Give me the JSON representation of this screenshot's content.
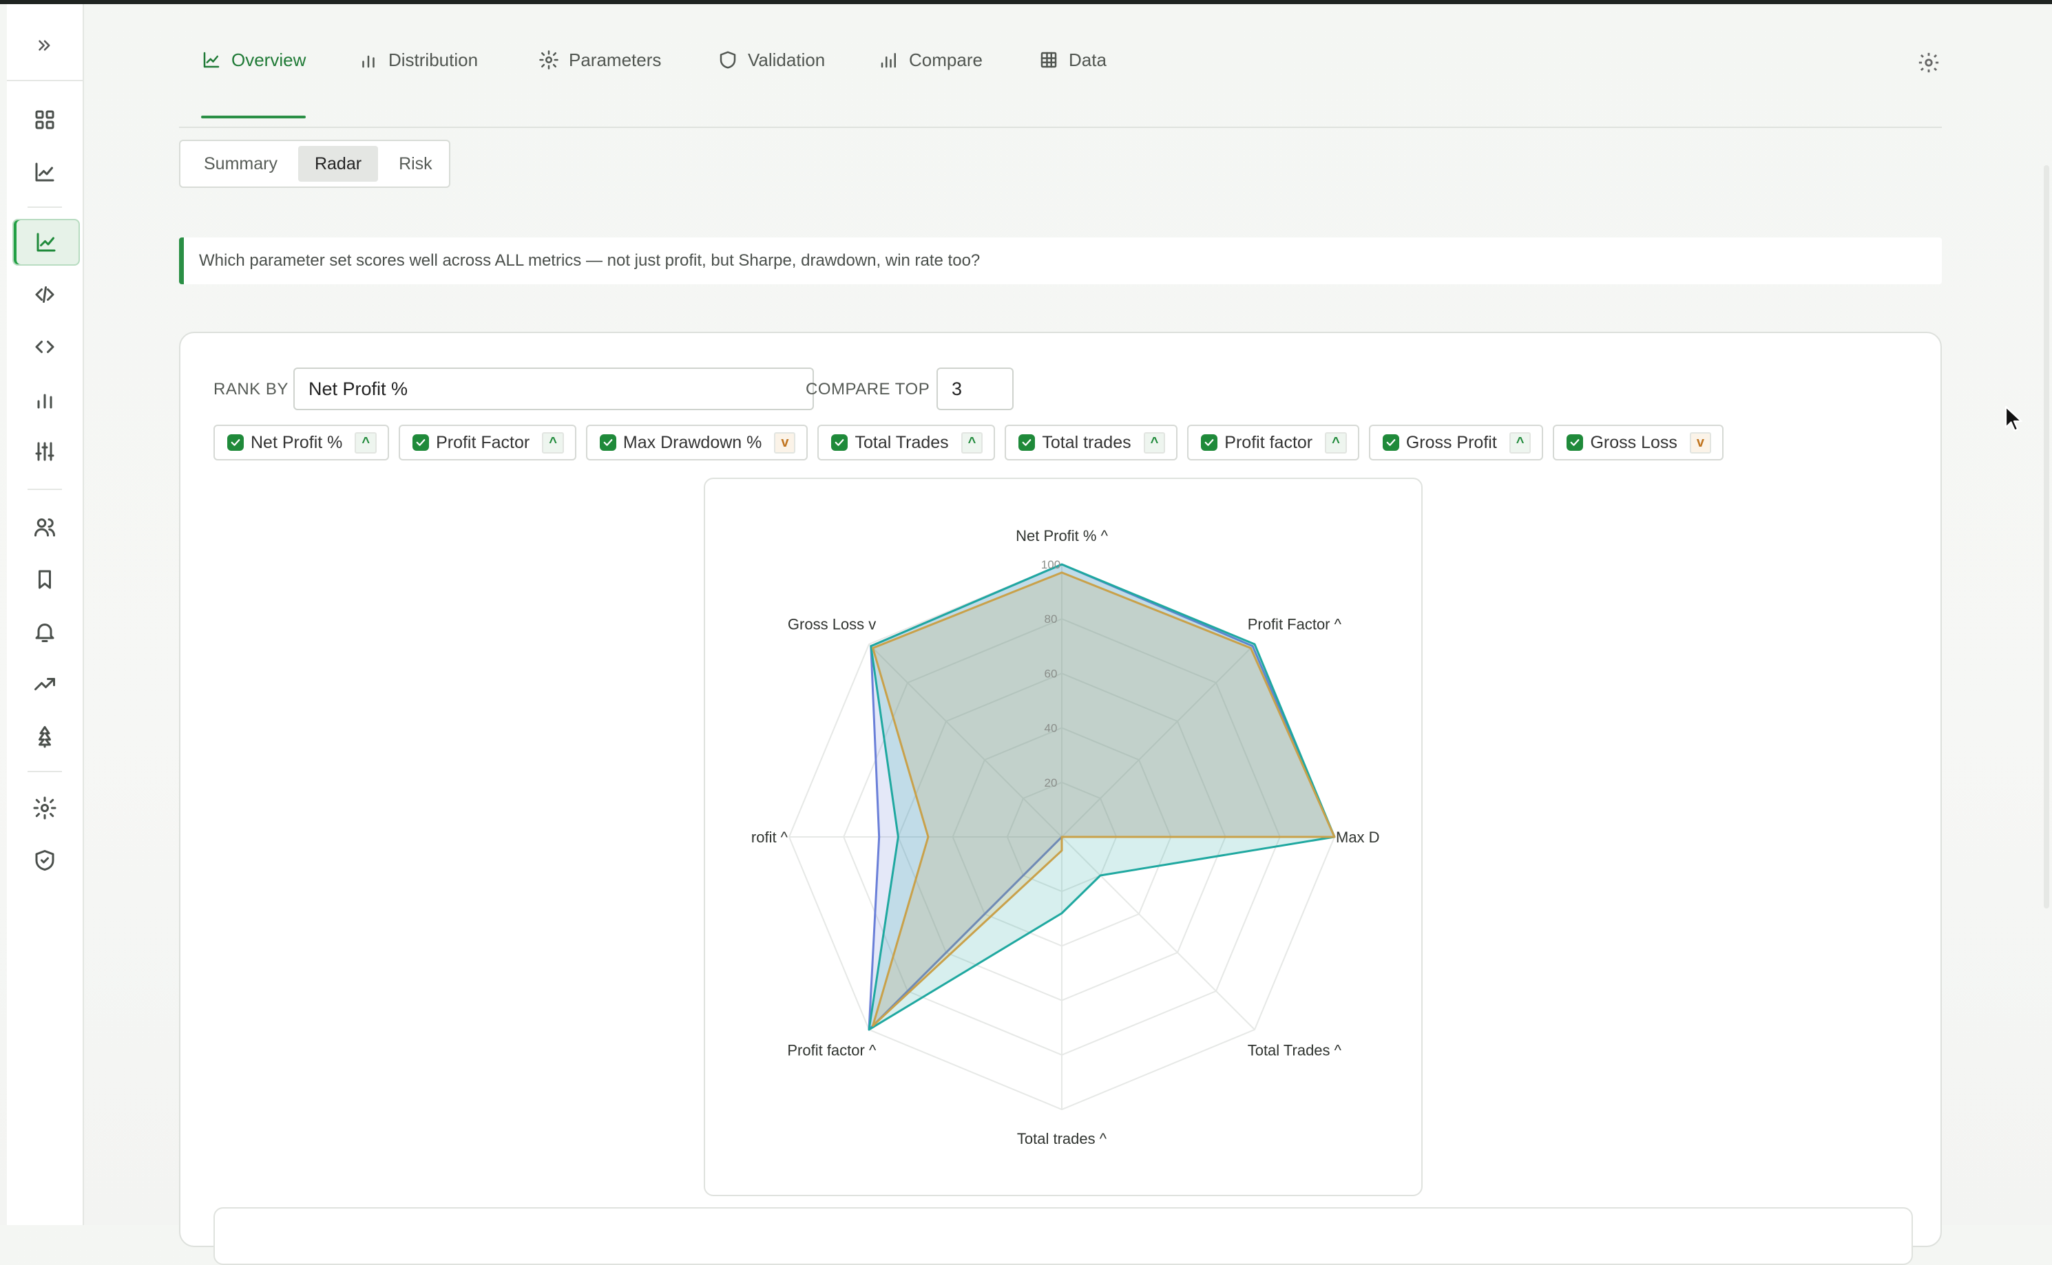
{
  "tabs": [
    {
      "label": "Overview",
      "icon": "line-chart-icon",
      "active": true
    },
    {
      "label": "Distribution",
      "icon": "bar-chart-icon"
    },
    {
      "label": "Parameters",
      "icon": "gear-icon"
    },
    {
      "label": "Validation",
      "icon": "shield-icon"
    },
    {
      "label": "Compare",
      "icon": "bar-chart-icon"
    },
    {
      "label": "Data",
      "icon": "table-icon"
    }
  ],
  "subtabs": [
    {
      "label": "Summary"
    },
    {
      "label": "Radar",
      "active": true
    },
    {
      "label": "Risk"
    }
  ],
  "question": "Which parameter set scores well across ALL metrics — not just profit, but Sharpe, drawdown, win rate too?",
  "controls": {
    "rank_by_label": "RANK BY",
    "rank_by_value": "Net Profit %",
    "compare_top_label": "COMPARE TOP",
    "compare_top_value": "3"
  },
  "metrics": [
    {
      "label": "Net Profit %",
      "dir": "^",
      "dir_type": "up"
    },
    {
      "label": "Profit Factor",
      "dir": "^",
      "dir_type": "up"
    },
    {
      "label": "Max Drawdown %",
      "dir": "v",
      "dir_type": "down"
    },
    {
      "label": "Total Trades",
      "dir": "^",
      "dir_type": "up"
    },
    {
      "label": "Total trades",
      "dir": "^",
      "dir_type": "up"
    },
    {
      "label": "Profit factor",
      "dir": "^",
      "dir_type": "up"
    },
    {
      "label": "Gross Profit",
      "dir": "^",
      "dir_type": "up"
    },
    {
      "label": "Gross Loss",
      "dir": "v",
      "dir_type": "down"
    }
  ],
  "colors": {
    "accent": "#2a8f45",
    "series": [
      "#6a7fd8",
      "#1fa8a0",
      "#c9a14a"
    ]
  },
  "chart_data": {
    "type": "radar",
    "axes": [
      "Net Profit % ^",
      "Profit Factor ^",
      "Max D",
      "Total Trades ^",
      "Total trades ^",
      "Profit factor ^",
      "rofit ^",
      "Gross Loss v"
    ],
    "ticks": [
      "20",
      "40",
      "60",
      "80",
      "100"
    ],
    "rmax": 100,
    "grid": true,
    "series": [
      {
        "values": [
          100,
          99,
          100,
          0,
          0,
          100,
          67,
          99
        ]
      },
      {
        "values": [
          100,
          100,
          100,
          20,
          28,
          100,
          60,
          99
        ]
      },
      {
        "values": [
          97,
          98,
          100,
          0,
          5,
          98,
          49,
          98
        ]
      }
    ]
  }
}
